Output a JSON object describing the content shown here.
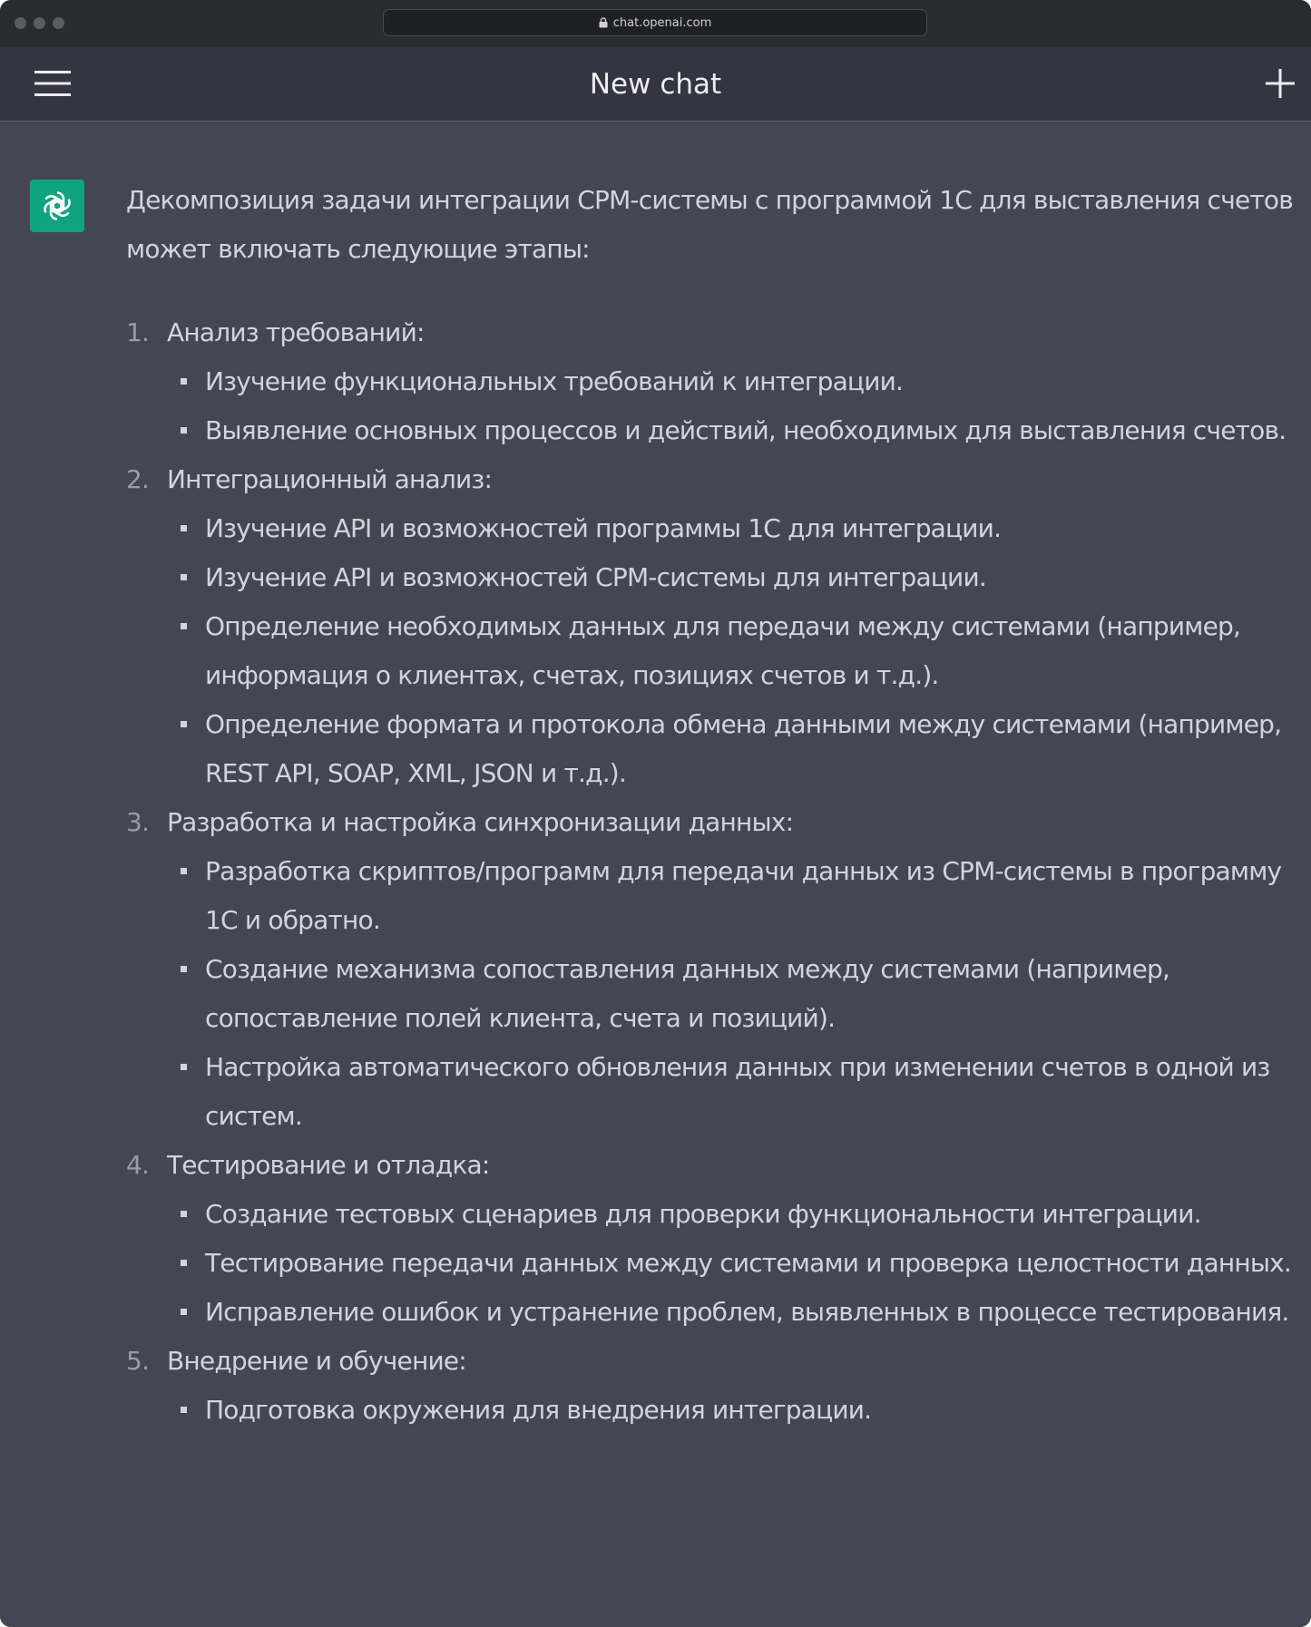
{
  "browser": {
    "url": "chat.openai.com"
  },
  "navbar": {
    "title": "New chat",
    "menu_icon": "hamburger-menu-icon",
    "new_chat_icon": "plus-icon"
  },
  "message": {
    "avatar_icon": "openai-logo-icon",
    "avatar_color": "#10a37f",
    "intro": "Декомпозиция задачи интеграции CPM-системы с программой 1С для выставления счетов может включать следующие этапы:",
    "steps": [
      {
        "number": "1.",
        "title": "Анализ требований:",
        "items": [
          "Изучение функциональных требований к интеграции.",
          "Выявление основных процессов и действий, необходимых для выставления счетов."
        ]
      },
      {
        "number": "2.",
        "title": "Интеграционный анализ:",
        "items": [
          "Изучение API и возможностей программы 1С для интеграции.",
          "Изучение API и возможностей CPM-системы для интеграции.",
          "Определение необходимых данных для передачи между системами (например, информация о клиентах, счетах, позициях счетов и т.д.).",
          "Определение формата и протокола обмена данными между системами (например, REST API, SOAP, XML, JSON и т.д.)."
        ]
      },
      {
        "number": "3.",
        "title": "Разработка и настройка синхронизации данных:",
        "items": [
          "Разработка скриптов/программ для передачи данных из CPM-системы в программу 1С и обратно.",
          "Создание механизма сопоставления данных между системами (например, сопоставление полей клиента, счета и позиций).",
          "Настройка автоматического обновления данных при изменении счетов в одной из систем."
        ]
      },
      {
        "number": "4.",
        "title": "Тестирование и отладка:",
        "items": [
          "Создание тестовых сценариев для проверки функциональности интеграции.",
          "Тестирование передачи данных между системами и проверка целостности данных.",
          "Исправление ошибок и устранение проблем, выявленных в процессе тестирования."
        ]
      },
      {
        "number": "5.",
        "title": "Внедрение и обучение:",
        "items": [
          "Подготовка окружения для внедрения интеграции."
        ]
      }
    ]
  },
  "colors": {
    "titlebar": "#2a2b31",
    "navbar": "#343541",
    "content": "#444654",
    "text": "#d1d5db"
  }
}
